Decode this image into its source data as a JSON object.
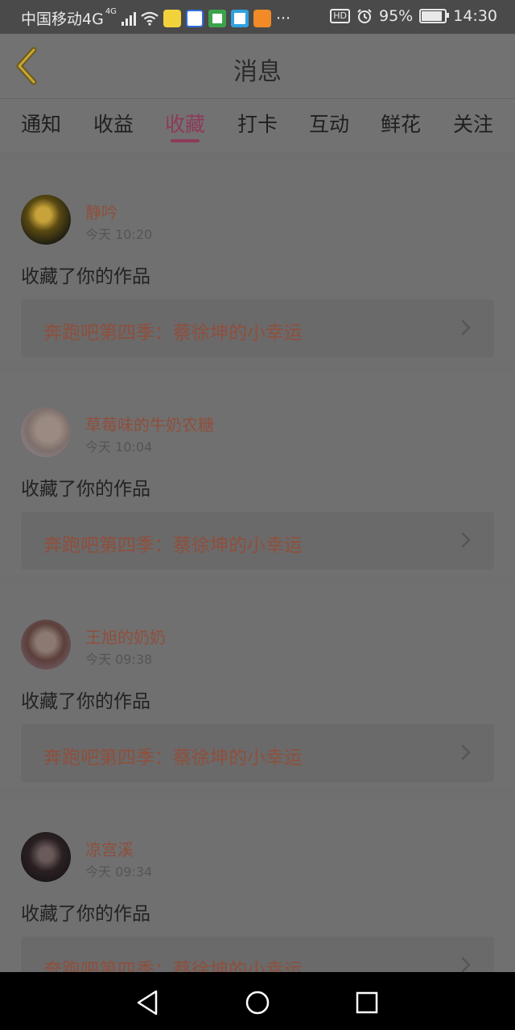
{
  "status_bar": {
    "carrier": "中国移动4G",
    "network_sup": "4G",
    "more": "···",
    "hd": "HD",
    "battery": "95%",
    "time": "14:30",
    "battery_level": 0.95
  },
  "header": {
    "title": "消息"
  },
  "tabs": [
    {
      "label": "通知"
    },
    {
      "label": "收益"
    },
    {
      "label": "收藏"
    },
    {
      "label": "打卡"
    },
    {
      "label": "互动"
    },
    {
      "label": "鲜花"
    },
    {
      "label": "关注"
    }
  ],
  "active_tab": "收藏",
  "messages": [
    {
      "user": "静吟",
      "time": "今天 10:20",
      "action": "收藏了你的作品",
      "work": "奔跑吧第四季：蔡徐坤的小幸运"
    },
    {
      "user": "草莓味的牛奶农糖",
      "time": "今天 10:04",
      "action": "收藏了你的作品",
      "work": "奔跑吧第四季：蔡徐坤的小幸运"
    },
    {
      "user": "王旭的奶奶",
      "time": "今天 09:38",
      "action": "收藏了你的作品",
      "work": "奔跑吧第四季：蔡徐坤的小幸运"
    },
    {
      "user": "凉宫溪",
      "time": "今天 09:34",
      "action": "收藏了你的作品",
      "work": "奔跑吧第四季：蔡徐坤的小幸运"
    }
  ],
  "colors": {
    "accent": "#8d3a5a",
    "username": "#8f4f3c",
    "overlay_bg": "#707070"
  }
}
